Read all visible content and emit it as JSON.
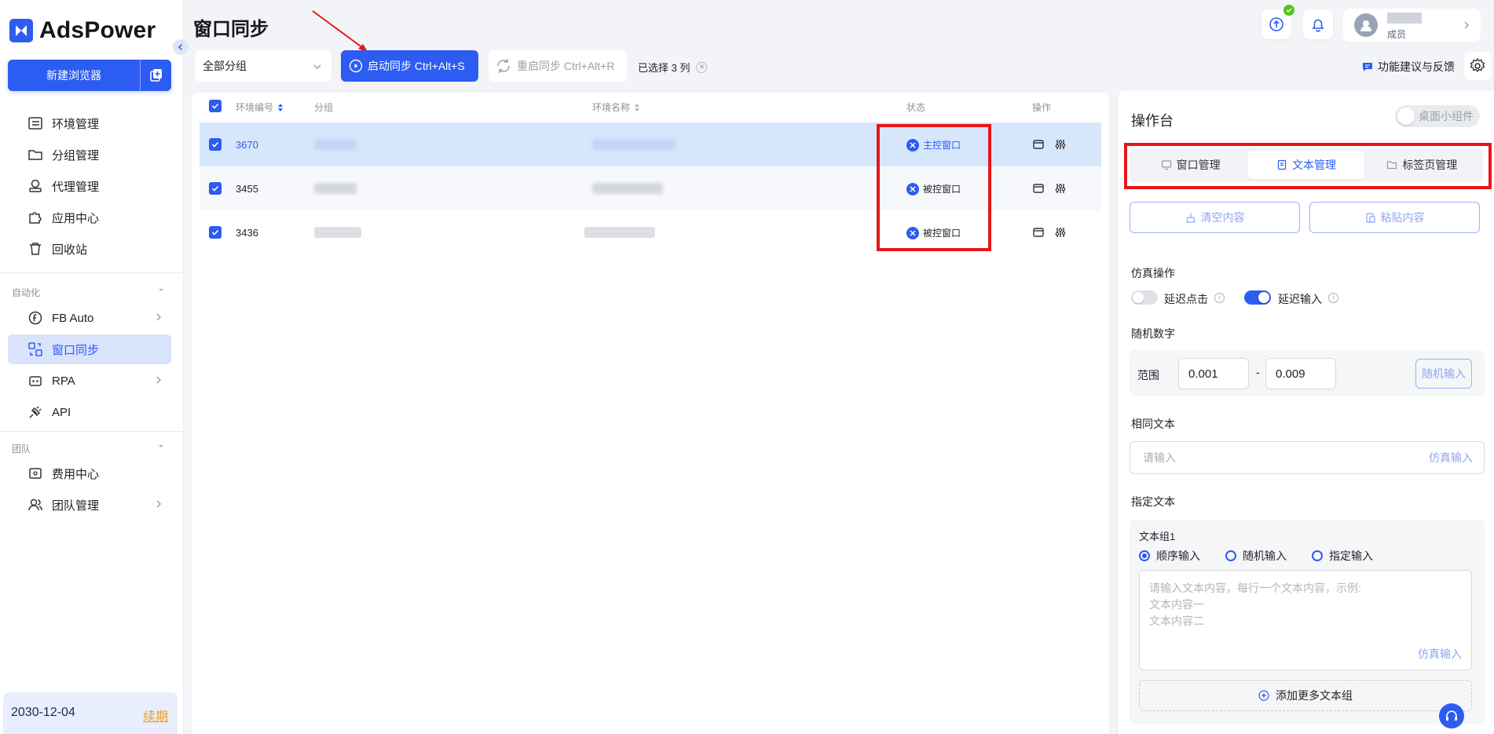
{
  "app": {
    "logo_text": "AdsPower",
    "brand_color": "#2c5cf2"
  },
  "sidebar": {
    "new_browser_label": "新建浏览器",
    "nav_items": [
      {
        "label": "环境管理",
        "icon": "list-icon"
      },
      {
        "label": "分组管理",
        "icon": "folder-icon"
      },
      {
        "label": "代理管理",
        "icon": "proxy-icon"
      },
      {
        "label": "应用中心",
        "icon": "puzzle-icon"
      },
      {
        "label": "回收站",
        "icon": "trash-icon"
      }
    ],
    "section_automation": "自动化",
    "automation_items": [
      {
        "label": "FB Auto",
        "icon": "fb-auto-icon"
      },
      {
        "label": "窗口同步",
        "icon": "window-sync-icon"
      },
      {
        "label": "RPA",
        "icon": "robot-icon"
      },
      {
        "label": "API",
        "icon": "plug-icon"
      }
    ],
    "section_team": "团队",
    "team_items": [
      {
        "label": "费用中心",
        "icon": "wallet-icon"
      },
      {
        "label": "团队管理",
        "icon": "team-icon"
      }
    ],
    "account": {
      "expiry_date": "2030-12-04",
      "renew_label": "续期"
    }
  },
  "header": {
    "page_title": "窗口同步",
    "user_role": "成员"
  },
  "toolbar": {
    "group_select_value": "全部分组",
    "start_sync_label": "启动同步 Ctrl+Alt+S",
    "restart_sync_label": "重启同步 Ctrl+Alt+R",
    "selected_info": "已选择 3 列",
    "feedback_label": "功能建议与反馈"
  },
  "table": {
    "columns": {
      "env_id": "环境编号",
      "group": "分组",
      "env_name": "环境名称",
      "status": "状态",
      "actions": "操作"
    },
    "rows": [
      {
        "env_id": "3670",
        "status": "主控窗口"
      },
      {
        "env_id": "3455",
        "status": "被控窗口"
      },
      {
        "env_id": "3436",
        "status": "被控窗口"
      }
    ]
  },
  "panel": {
    "title": "操作台",
    "desktop_widget_label": "桌面小组件",
    "tabs": [
      {
        "label": "窗口管理",
        "icon": "monitor-icon"
      },
      {
        "label": "文本管理",
        "icon": "document-icon"
      },
      {
        "label": "标签页管理",
        "icon": "tab-folder-icon"
      }
    ],
    "clear_label": "清空内容",
    "paste_label": "粘贴内容",
    "simulation_title": "仿真操作",
    "delay_click_label": "延迟点击",
    "delay_input_label": "延迟输入",
    "random_number_title": "随机数字",
    "range_label": "范围",
    "range_min": "0.001",
    "range_sep": "-",
    "range_max": "0.009",
    "random_input_label": "随机输入",
    "same_text_title": "相同文本",
    "same_text_placeholder": "请输入",
    "simulate_input_label": "仿真输入",
    "specified_text_title": "指定文本",
    "text_group_label": "文本组1",
    "radio_sequential": "顺序输入",
    "radio_random": "随机输入",
    "radio_specified": "指定输入",
    "textarea_placeholder_1": "请输入文本内容，每行一个文本内容，示例:",
    "textarea_placeholder_2": "文本内容一",
    "textarea_placeholder_3": "文本内容二",
    "add_group_label": "添加更多文本组"
  }
}
